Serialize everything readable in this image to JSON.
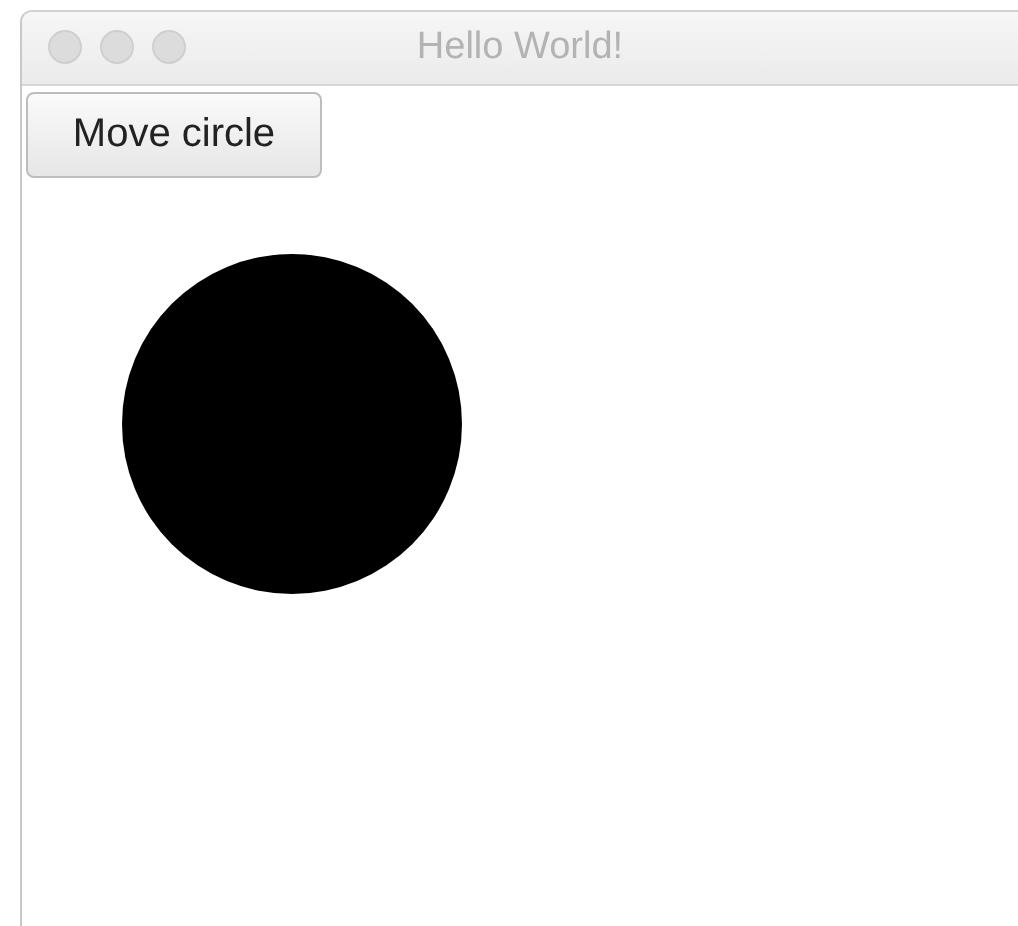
{
  "window": {
    "title": "Hello World!"
  },
  "button": {
    "label": "Move circle"
  }
}
